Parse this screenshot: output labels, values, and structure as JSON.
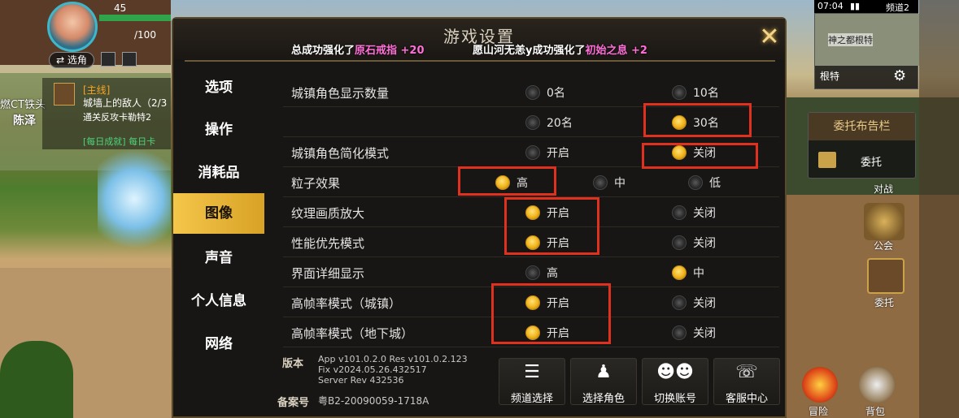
{
  "hud": {
    "level": "45",
    "hp": "/100",
    "switch_char": "⇄ 选角",
    "quest_type": "[主线]",
    "quest_name": "城墙上的敌人（2/3",
    "quest_desc": "通关反攻卡勒特2",
    "daily": "[每日成就] 每日卡",
    "side_name_1": "燃CT铁头",
    "side_name_2": "陈泽"
  },
  "status_bar": {
    "time": "07:04",
    "channel": "频道2"
  },
  "minimap": {
    "title": "神之都根特",
    "location": "根特"
  },
  "commission_board": {
    "title": "委托布告栏",
    "button": "委托"
  },
  "right_labels": {
    "battle": "对战",
    "guild": "公会",
    "commission": "委托",
    "adventure": "冒险",
    "bag": "背包"
  },
  "panel": {
    "title": "游戏设置",
    "ticker_1": {
      "prefix": "总成功强化了",
      "item": "原石戒指 +20"
    },
    "ticker_2": {
      "prefix": "愿山河无恙y成功强化了",
      "item": "初始之息 +2"
    },
    "close_icon": "✕"
  },
  "sidebar": {
    "items": [
      {
        "label": "选项"
      },
      {
        "label": "操作"
      },
      {
        "label": "消耗品"
      },
      {
        "label": "图像"
      },
      {
        "label": "声音"
      },
      {
        "label": "个人信息"
      },
      {
        "label": "网络"
      }
    ],
    "active_index": 3
  },
  "settings": {
    "rows": [
      {
        "label": "城镇角色显示数量",
        "options": [
          {
            "label": "0名",
            "selected": false
          },
          {
            "label": "10名",
            "selected": false
          }
        ]
      },
      {
        "label": "",
        "options": [
          {
            "label": "20名",
            "selected": false
          },
          {
            "label": "30名",
            "selected": true
          }
        ]
      },
      {
        "label": "城镇角色简化模式",
        "options": [
          {
            "label": "开启",
            "selected": false
          },
          {
            "label": "关闭",
            "selected": true
          }
        ]
      },
      {
        "label": "粒子效果",
        "options": [
          {
            "label": "高",
            "selected": true
          },
          {
            "label": "中",
            "selected": false
          },
          {
            "label": "低",
            "selected": false
          }
        ]
      },
      {
        "label": "纹理画质放大",
        "options": [
          {
            "label": "开启",
            "selected": true
          },
          {
            "label": "关闭",
            "selected": false
          }
        ]
      },
      {
        "label": "性能优先模式",
        "options": [
          {
            "label": "开启",
            "selected": true
          },
          {
            "label": "关闭",
            "selected": false
          }
        ]
      },
      {
        "label": "界面详细显示",
        "options": [
          {
            "label": "高",
            "selected": false
          },
          {
            "label": "中",
            "selected": true
          }
        ]
      },
      {
        "label": "高帧率模式（城镇）",
        "options": [
          {
            "label": "开启",
            "selected": true
          },
          {
            "label": "关闭",
            "selected": false
          }
        ]
      },
      {
        "label": "高帧率模式（地下城）",
        "options": [
          {
            "label": "开启",
            "selected": true
          },
          {
            "label": "关闭",
            "selected": false
          }
        ]
      }
    ]
  },
  "footer": {
    "version_label": "版本",
    "version_app": "App v101.0.2.0 Res v101.0.2.123",
    "version_fix": "Fix v2024.05.26.432517",
    "version_server": "Server Rev 432536",
    "icp_label": "备案号",
    "icp_value": "粤B2-20090059-1718A",
    "buttons": [
      {
        "label": "频道选择",
        "icon": "list-icon"
      },
      {
        "label": "选择角色",
        "icon": "person-icon"
      },
      {
        "label": "切换账号",
        "icon": "users-icon"
      },
      {
        "label": "客服中心",
        "icon": "headset-icon"
      }
    ]
  },
  "colors": {
    "accent_gold": "#f4c64a",
    "ticker_highlight": "#ff6fd8",
    "annotation_red": "#e0301e",
    "panel_bg": "#181614"
  }
}
